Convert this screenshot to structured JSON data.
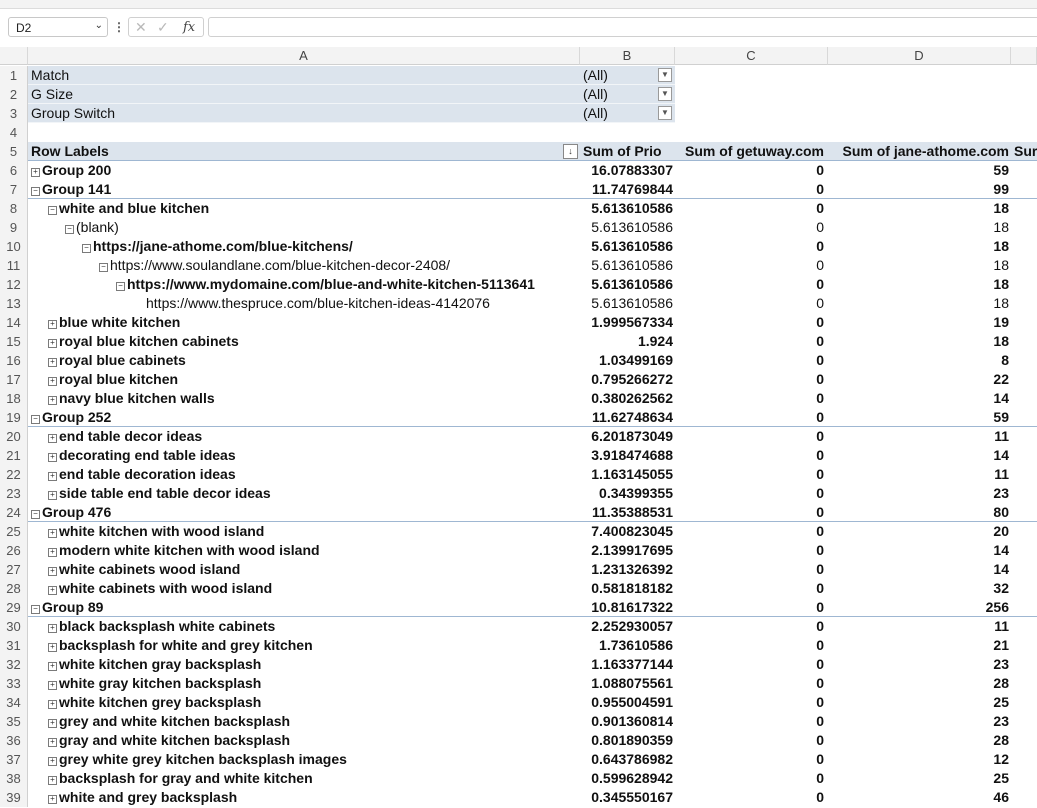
{
  "formula_bar": {
    "name_box": "D2",
    "formula": ""
  },
  "columns": {
    "A": "A",
    "B": "B",
    "C": "C",
    "D": "D"
  },
  "filters": [
    {
      "rn": "1",
      "label": "Match",
      "value": "(All)"
    },
    {
      "rn": "2",
      "label": "G Size",
      "value": "(All)"
    },
    {
      "rn": "3",
      "label": "Group Switch",
      "value": "(All)"
    }
  ],
  "blank_rows": {
    "r4": "4"
  },
  "header": {
    "rn": "5",
    "row_labels": "Row Labels",
    "col_b": "Sum of Prio",
    "col_c": "Sum of getuway.com",
    "col_d": "Sum of jane-athome.com",
    "col_e": "Sur"
  },
  "rows": [
    {
      "rn": "6",
      "indent": 0,
      "toggle": "+",
      "bold": true,
      "group": false,
      "label": "Group 200",
      "b": "16.07883307",
      "c": "0",
      "d": "59"
    },
    {
      "rn": "7",
      "indent": 0,
      "toggle": "-",
      "bold": true,
      "group": true,
      "label": "Group 141",
      "b": "11.74769844",
      "c": "0",
      "d": "99"
    },
    {
      "rn": "8",
      "indent": 1,
      "toggle": "-",
      "bold": true,
      "group": false,
      "label": "white and blue kitchen",
      "b": "5.613610586",
      "c": "0",
      "d": "18"
    },
    {
      "rn": "9",
      "indent": 2,
      "toggle": "-",
      "bold": false,
      "group": false,
      "label": "(blank)",
      "b": "5.613610586",
      "c": "0",
      "d": "18"
    },
    {
      "rn": "10",
      "indent": 3,
      "toggle": "-",
      "bold": true,
      "group": false,
      "label": "https://jane-athome.com/blue-kitchens/",
      "b": "5.613610586",
      "c": "0",
      "d": "18"
    },
    {
      "rn": "11",
      "indent": 4,
      "toggle": "-",
      "bold": false,
      "group": false,
      "label": "https://www.soulandlane.com/blue-kitchen-decor-2408/",
      "b": "5.613610586",
      "c": "0",
      "d": "18"
    },
    {
      "rn": "12",
      "indent": 5,
      "toggle": "-",
      "bold": true,
      "group": false,
      "label": "https://www.mydomaine.com/blue-and-white-kitchen-5113641",
      "b": "5.613610586",
      "c": "0",
      "d": "18"
    },
    {
      "rn": "13",
      "indent": 6,
      "toggle": "",
      "bold": false,
      "group": false,
      "label": "https://www.thespruce.com/blue-kitchen-ideas-4142076",
      "b": "5.613610586",
      "c": "0",
      "d": "18"
    },
    {
      "rn": "14",
      "indent": 1,
      "toggle": "+",
      "bold": true,
      "group": false,
      "label": "blue white kitchen",
      "b": "1.999567334",
      "c": "0",
      "d": "19"
    },
    {
      "rn": "15",
      "indent": 1,
      "toggle": "+",
      "bold": true,
      "group": false,
      "label": "royal blue kitchen cabinets",
      "b": "1.924",
      "c": "0",
      "d": "18"
    },
    {
      "rn": "16",
      "indent": 1,
      "toggle": "+",
      "bold": true,
      "group": false,
      "label": "royal blue cabinets",
      "b": "1.03499169",
      "c": "0",
      "d": "8"
    },
    {
      "rn": "17",
      "indent": 1,
      "toggle": "+",
      "bold": true,
      "group": false,
      "label": "royal blue kitchen",
      "b": "0.795266272",
      "c": "0",
      "d": "22"
    },
    {
      "rn": "18",
      "indent": 1,
      "toggle": "+",
      "bold": true,
      "group": false,
      "label": "navy blue kitchen walls",
      "b": "0.380262562",
      "c": "0",
      "d": "14"
    },
    {
      "rn": "19",
      "indent": 0,
      "toggle": "-",
      "bold": true,
      "group": true,
      "label": "Group 252",
      "b": "11.62748634",
      "c": "0",
      "d": "59"
    },
    {
      "rn": "20",
      "indent": 1,
      "toggle": "+",
      "bold": true,
      "group": false,
      "label": "end table decor ideas",
      "b": "6.201873049",
      "c": "0",
      "d": "11"
    },
    {
      "rn": "21",
      "indent": 1,
      "toggle": "+",
      "bold": true,
      "group": false,
      "label": "decorating end table ideas",
      "b": "3.918474688",
      "c": "0",
      "d": "14"
    },
    {
      "rn": "22",
      "indent": 1,
      "toggle": "+",
      "bold": true,
      "group": false,
      "label": "end table decoration ideas",
      "b": "1.163145055",
      "c": "0",
      "d": "11"
    },
    {
      "rn": "23",
      "indent": 1,
      "toggle": "+",
      "bold": true,
      "group": false,
      "label": "side table end table decor ideas",
      "b": "0.34399355",
      "c": "0",
      "d": "23"
    },
    {
      "rn": "24",
      "indent": 0,
      "toggle": "-",
      "bold": true,
      "group": true,
      "label": "Group 476",
      "b": "11.35388531",
      "c": "0",
      "d": "80"
    },
    {
      "rn": "25",
      "indent": 1,
      "toggle": "+",
      "bold": true,
      "group": false,
      "label": "white kitchen with wood island",
      "b": "7.400823045",
      "c": "0",
      "d": "20"
    },
    {
      "rn": "26",
      "indent": 1,
      "toggle": "+",
      "bold": true,
      "group": false,
      "label": "modern white kitchen with wood island",
      "b": "2.139917695",
      "c": "0",
      "d": "14"
    },
    {
      "rn": "27",
      "indent": 1,
      "toggle": "+",
      "bold": true,
      "group": false,
      "label": "white cabinets wood island",
      "b": "1.231326392",
      "c": "0",
      "d": "14"
    },
    {
      "rn": "28",
      "indent": 1,
      "toggle": "+",
      "bold": true,
      "group": false,
      "label": "white cabinets with wood island",
      "b": "0.581818182",
      "c": "0",
      "d": "32"
    },
    {
      "rn": "29",
      "indent": 0,
      "toggle": "-",
      "bold": true,
      "group": true,
      "label": "Group 89",
      "b": "10.81617322",
      "c": "0",
      "d": "256"
    },
    {
      "rn": "30",
      "indent": 1,
      "toggle": "+",
      "bold": true,
      "group": false,
      "label": "black backsplash white cabinets",
      "b": "2.252930057",
      "c": "0",
      "d": "11"
    },
    {
      "rn": "31",
      "indent": 1,
      "toggle": "+",
      "bold": true,
      "group": false,
      "label": "backsplash for white and grey kitchen",
      "b": "1.73610586",
      "c": "0",
      "d": "21"
    },
    {
      "rn": "32",
      "indent": 1,
      "toggle": "+",
      "bold": true,
      "group": false,
      "label": "white kitchen gray backsplash",
      "b": "1.163377144",
      "c": "0",
      "d": "23"
    },
    {
      "rn": "33",
      "indent": 1,
      "toggle": "+",
      "bold": true,
      "group": false,
      "label": "white gray kitchen backsplash",
      "b": "1.088075561",
      "c": "0",
      "d": "28"
    },
    {
      "rn": "34",
      "indent": 1,
      "toggle": "+",
      "bold": true,
      "group": false,
      "label": "white kitchen grey backsplash",
      "b": "0.955004591",
      "c": "0",
      "d": "25"
    },
    {
      "rn": "35",
      "indent": 1,
      "toggle": "+",
      "bold": true,
      "group": false,
      "label": "grey and white kitchen backsplash",
      "b": "0.901360814",
      "c": "0",
      "d": "23"
    },
    {
      "rn": "36",
      "indent": 1,
      "toggle": "+",
      "bold": true,
      "group": false,
      "label": "gray and white kitchen backsplash",
      "b": "0.801890359",
      "c": "0",
      "d": "28"
    },
    {
      "rn": "37",
      "indent": 1,
      "toggle": "+",
      "bold": true,
      "group": false,
      "label": "grey white grey kitchen backsplash images",
      "b": "0.643786982",
      "c": "0",
      "d": "12"
    },
    {
      "rn": "38",
      "indent": 1,
      "toggle": "+",
      "bold": true,
      "group": false,
      "label": "backsplash for gray and white kitchen",
      "b": "0.599628942",
      "c": "0",
      "d": "25"
    },
    {
      "rn": "39",
      "indent": 1,
      "toggle": "+",
      "bold": true,
      "group": false,
      "label": "white and grey backsplash",
      "b": "0.345550167",
      "c": "0",
      "d": "46"
    }
  ]
}
